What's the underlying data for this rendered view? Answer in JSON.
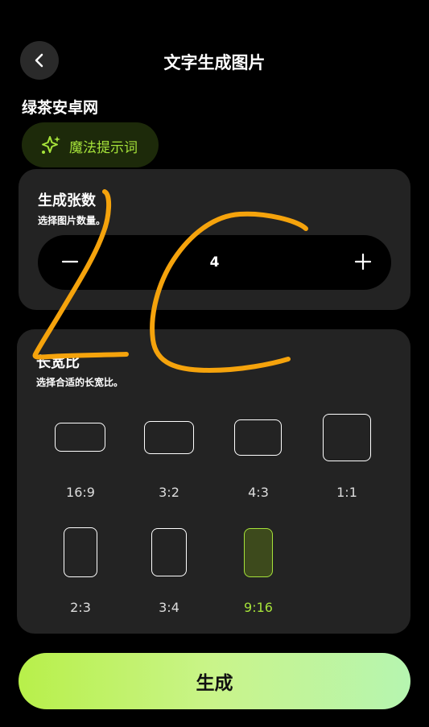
{
  "header": {
    "title": "文字生成图片"
  },
  "prompt": {
    "text": "绿茶安卓网",
    "magic_label": "魔法提示词"
  },
  "count_card": {
    "title": "生成张数",
    "subtitle": "选择图片数量。",
    "value": "4"
  },
  "ratio_card": {
    "title": "长宽比",
    "subtitle": "选择合适的长宽比。",
    "options": [
      {
        "label": "16:9"
      },
      {
        "label": "3:2"
      },
      {
        "label": "4:3"
      },
      {
        "label": "1:1"
      },
      {
        "label": "2:3"
      },
      {
        "label": "3:4"
      },
      {
        "label": "9:16",
        "selected": true
      }
    ]
  },
  "generate_label": "生成",
  "colors": {
    "accent": "#a6e33a",
    "scribble": "#f5a30c",
    "card": "#232323"
  }
}
